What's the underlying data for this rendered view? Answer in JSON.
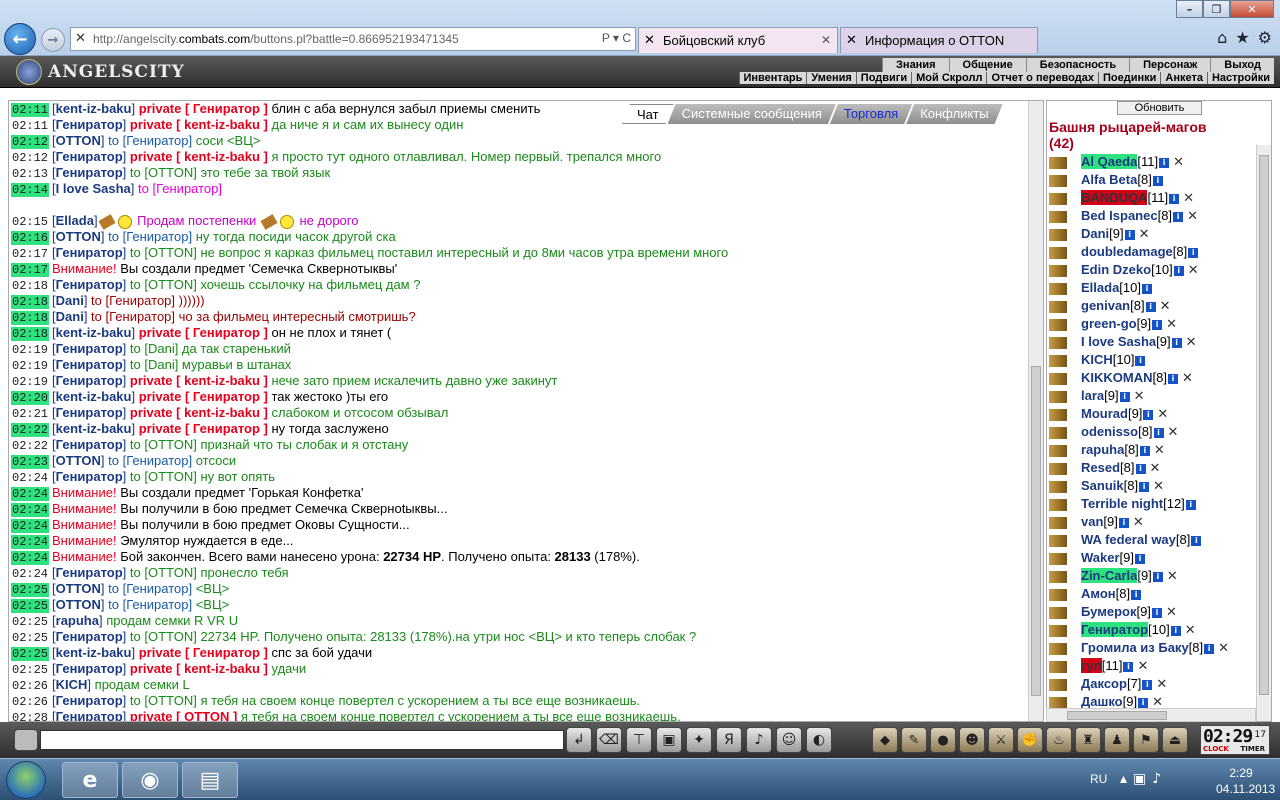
{
  "browser": {
    "url_prefix": "http://angelscity.",
    "url_host": "combats.com",
    "url_path": "/buttons.pl?battle=0.866952193471345",
    "url_tools": "P ▾ C",
    "tabs": [
      {
        "label": "Бойцовский клуб"
      },
      {
        "label": "Информация о OTTON"
      }
    ]
  },
  "site": {
    "logo": "ANGELSCITY",
    "menu_top": [
      "Знания",
      "Общение",
      "Безопасность",
      "Персонаж",
      "Выход"
    ],
    "menu_bottom": [
      "Инвентарь",
      "Умения",
      "Подвиги",
      "Мой Скролл",
      "Отчет о переводах",
      "Поединки",
      "Анкета",
      "Настройки"
    ]
  },
  "chat_tabs": [
    "Чат",
    "Системные сообщения",
    "Торговля",
    "Конфликты"
  ],
  "chat": [
    {
      "t": "02:11",
      "hl": true,
      "parts": [
        [
          "br",
          "["
        ],
        [
          "nick",
          "kent-iz-baku"
        ],
        [
          "br",
          "]"
        ],
        [
          "priv",
          " private [ Гениратор ] "
        ],
        [
          "sys",
          "блин с аба вернулся забыл приемы сменить"
        ]
      ]
    },
    {
      "t": "02:11",
      "hl": false,
      "parts": [
        [
          "br",
          "["
        ],
        [
          "nick",
          "Гениратор"
        ],
        [
          "br",
          "]"
        ],
        [
          "priv",
          " private [ kent-iz-baku ] "
        ],
        [
          "plain",
          "да ниче я и сам их вынесу один"
        ]
      ]
    },
    {
      "t": "02:12",
      "hl": true,
      "parts": [
        [
          "br",
          "["
        ],
        [
          "nick",
          "OTTON"
        ],
        [
          "br",
          "]"
        ],
        [
          "blue",
          " to [Гениратор] "
        ],
        [
          "plain",
          "соси <ВЦ>"
        ]
      ]
    },
    {
      "t": "02:12",
      "hl": false,
      "parts": [
        [
          "br",
          "["
        ],
        [
          "nick",
          "Гениратор"
        ],
        [
          "br",
          "]"
        ],
        [
          "priv",
          " private [ kent-iz-baku ] "
        ],
        [
          "plain",
          "я просто тут одного отлавливал. Номер первый. трепался много"
        ]
      ]
    },
    {
      "t": "02:13",
      "hl": false,
      "parts": [
        [
          "br",
          "["
        ],
        [
          "nick",
          "Гениратор"
        ],
        [
          "br",
          "]"
        ],
        [
          "plain",
          " to [OTTON] это тебе за твой язык"
        ]
      ]
    },
    {
      "t": "02:14",
      "hl": true,
      "parts": [
        [
          "br",
          "["
        ],
        [
          "nick",
          "I love Sasha"
        ],
        [
          "br",
          "]"
        ],
        [
          "magenta",
          " to [Гениратор]"
        ]
      ]
    },
    {
      "t": "",
      "hl": false,
      "parts": []
    },
    {
      "t": "02:15",
      "hl": false,
      "parts": [
        [
          "br",
          "["
        ],
        [
          "nick",
          "Ellada"
        ],
        [
          "br",
          "]"
        ],
        [
          "gavel",
          ""
        ],
        [
          "smiley",
          ""
        ],
        [
          "ellada",
          " Продам постепенки "
        ],
        [
          "gavel",
          ""
        ],
        [
          "smiley",
          ""
        ],
        [
          "ellada",
          " не дорого"
        ]
      ]
    },
    {
      "t": "02:16",
      "hl": true,
      "parts": [
        [
          "br",
          "["
        ],
        [
          "nick",
          "OTTON"
        ],
        [
          "br",
          "]"
        ],
        [
          "blue",
          " to [Гениратор] "
        ],
        [
          "plain",
          "ну тогда посиди часок другой ска"
        ]
      ]
    },
    {
      "t": "02:17",
      "hl": false,
      "parts": [
        [
          "br",
          "["
        ],
        [
          "nick",
          "Гениратор"
        ],
        [
          "br",
          "]"
        ],
        [
          "plain",
          " to [OTTON] не вопрос я карказ фильмец поставил интересный и до 8ми часов утра времени много"
        ]
      ]
    },
    {
      "t": "02:17",
      "hl": true,
      "parts": [
        [
          "warn",
          "Внимание! "
        ],
        [
          "sys",
          "Вы создали предмет 'Семечка Сквернотыквы'"
        ]
      ]
    },
    {
      "t": "02:18",
      "hl": false,
      "parts": [
        [
          "br",
          "["
        ],
        [
          "nick",
          "Гениратор"
        ],
        [
          "br",
          "]"
        ],
        [
          "plain",
          " to [OTTON] хочешь ссылочку на фильмец дам ?"
        ]
      ]
    },
    {
      "t": "02:18",
      "hl": true,
      "parts": [
        [
          "br",
          "["
        ],
        [
          "nick",
          "Dani"
        ],
        [
          "br",
          "]"
        ],
        [
          "darkred",
          " to [Гениратор] ))))))"
        ]
      ]
    },
    {
      "t": "02:18",
      "hl": true,
      "parts": [
        [
          "br",
          "["
        ],
        [
          "nick",
          "Dani"
        ],
        [
          "br",
          "]"
        ],
        [
          "darkred",
          " to [Гениратор] чо за фильмец интересный смотришь?"
        ]
      ]
    },
    {
      "t": "02:18",
      "hl": true,
      "parts": [
        [
          "br",
          "["
        ],
        [
          "nick",
          "kent-iz-baku"
        ],
        [
          "br",
          "]"
        ],
        [
          "priv",
          " private [ Гениратор ] "
        ],
        [
          "sys",
          "он не плох и тянет ("
        ]
      ]
    },
    {
      "t": "02:19",
      "hl": false,
      "parts": [
        [
          "br",
          "["
        ],
        [
          "nick",
          "Гениратор"
        ],
        [
          "br",
          "]"
        ],
        [
          "plain",
          " to [Dani] да так старенький"
        ]
      ]
    },
    {
      "t": "02:19",
      "hl": false,
      "parts": [
        [
          "br",
          "["
        ],
        [
          "nick",
          "Гениратор"
        ],
        [
          "br",
          "]"
        ],
        [
          "plain",
          " to [Dani] муравьи в штанах"
        ]
      ]
    },
    {
      "t": "02:19",
      "hl": false,
      "parts": [
        [
          "br",
          "["
        ],
        [
          "nick",
          "Гениратор"
        ],
        [
          "br",
          "]"
        ],
        [
          "priv",
          " private [ kent-iz-baku ] "
        ],
        [
          "plain",
          "нече зато прием искалечить давно уже закинут"
        ]
      ]
    },
    {
      "t": "02:20",
      "hl": true,
      "parts": [
        [
          "br",
          "["
        ],
        [
          "nick",
          "kent-iz-baku"
        ],
        [
          "br",
          "]"
        ],
        [
          "priv",
          " private [ Гениратор ] "
        ],
        [
          "sys",
          "так жестоко )ты его"
        ]
      ]
    },
    {
      "t": "02:21",
      "hl": false,
      "parts": [
        [
          "br",
          "["
        ],
        [
          "nick",
          "Гениратор"
        ],
        [
          "br",
          "]"
        ],
        [
          "priv",
          " private [ kent-iz-baku ] "
        ],
        [
          "plain",
          "слабоком и отсосом обзывал"
        ]
      ]
    },
    {
      "t": "02:22",
      "hl": true,
      "parts": [
        [
          "br",
          "["
        ],
        [
          "nick",
          "kent-iz-baku"
        ],
        [
          "br",
          "]"
        ],
        [
          "priv",
          " private [ Гениратор ] "
        ],
        [
          "sys",
          "ну тогда заслужено"
        ]
      ]
    },
    {
      "t": "02:22",
      "hl": false,
      "parts": [
        [
          "br",
          "["
        ],
        [
          "nick",
          "Гениратор"
        ],
        [
          "br",
          "]"
        ],
        [
          "plain",
          " to [OTTON] признай что ты слобак и я отстану"
        ]
      ]
    },
    {
      "t": "02:23",
      "hl": true,
      "parts": [
        [
          "br",
          "["
        ],
        [
          "nick",
          "OTTON"
        ],
        [
          "br",
          "]"
        ],
        [
          "blue",
          " to [Гениратор] "
        ],
        [
          "plain",
          "отсоси"
        ]
      ]
    },
    {
      "t": "02:24",
      "hl": false,
      "parts": [
        [
          "br",
          "["
        ],
        [
          "nick",
          "Гениратор"
        ],
        [
          "br",
          "]"
        ],
        [
          "plain",
          " to [OTTON] ну вот опять"
        ]
      ]
    },
    {
      "t": "02:24",
      "hl": true,
      "parts": [
        [
          "warn",
          "Внимание! "
        ],
        [
          "sys",
          "Вы создали предмет 'Горькая Конфетка'"
        ]
      ]
    },
    {
      "t": "02:24",
      "hl": true,
      "parts": [
        [
          "warn",
          "Внимание! "
        ],
        [
          "sys",
          "Вы получили в бою предмет Семечка Скверноtыквы..."
        ]
      ]
    },
    {
      "t": "02:24",
      "hl": true,
      "parts": [
        [
          "warn",
          "Внимание! "
        ],
        [
          "sys",
          "Вы получили в бою предмет Оковы Сущности..."
        ]
      ]
    },
    {
      "t": "02:24",
      "hl": true,
      "parts": [
        [
          "warn",
          "Внимание! "
        ],
        [
          "sys",
          "Эмулятор нуждается в еде..."
        ]
      ]
    },
    {
      "t": "02:24",
      "hl": true,
      "parts": [
        [
          "warn",
          "Внимание! "
        ],
        [
          "sys",
          "Бой закончен. Всего вами нанесено урона: "
        ],
        [
          "sysb",
          "22734 HP"
        ],
        [
          "sys",
          ". Получено опыта: "
        ],
        [
          "sysb",
          "28133"
        ],
        [
          "sys",
          " (178%)."
        ]
      ]
    },
    {
      "t": "02:24",
      "hl": false,
      "parts": [
        [
          "br",
          "["
        ],
        [
          "nick",
          "Гениратор"
        ],
        [
          "br",
          "]"
        ],
        [
          "plain",
          " to [OTTON] пронесло тебя"
        ]
      ]
    },
    {
      "t": "02:25",
      "hl": true,
      "parts": [
        [
          "br",
          "["
        ],
        [
          "nick",
          "OTTON"
        ],
        [
          "br",
          "]"
        ],
        [
          "blue",
          " to [Гениратор] "
        ],
        [
          "plain",
          "<ВЦ>"
        ]
      ]
    },
    {
      "t": "02:25",
      "hl": true,
      "parts": [
        [
          "br",
          "["
        ],
        [
          "nick",
          "OTTON"
        ],
        [
          "br",
          "]"
        ],
        [
          "blue",
          " to [Гениратор] "
        ],
        [
          "plain",
          "<ВЦ>"
        ]
      ]
    },
    {
      "t": "02:25",
      "hl": false,
      "parts": [
        [
          "br",
          "["
        ],
        [
          "nick",
          "rapuha"
        ],
        [
          "br",
          "]"
        ],
        [
          "plain",
          " продам семки R VR U"
        ]
      ]
    },
    {
      "t": "02:25",
      "hl": false,
      "parts": [
        [
          "br",
          "["
        ],
        [
          "nick",
          "Гениратор"
        ],
        [
          "br",
          "]"
        ],
        [
          "plain",
          " to [OTTON] 22734 HP. Получено опыта: 28133 (178%).на утри нос <ВЦ> и кто теперь слобак ?"
        ]
      ]
    },
    {
      "t": "02:25",
      "hl": true,
      "parts": [
        [
          "br",
          "["
        ],
        [
          "nick",
          "kent-iz-baku"
        ],
        [
          "br",
          "]"
        ],
        [
          "priv",
          " private [ Гениратор ] "
        ],
        [
          "sys",
          "спс за бой удачи"
        ]
      ]
    },
    {
      "t": "02:25",
      "hl": false,
      "parts": [
        [
          "br",
          "["
        ],
        [
          "nick",
          "Гениратор"
        ],
        [
          "br",
          "]"
        ],
        [
          "priv",
          " private [ kent-iz-baku ] "
        ],
        [
          "plain",
          "удачи"
        ]
      ]
    },
    {
      "t": "02:26",
      "hl": false,
      "parts": [
        [
          "br",
          "["
        ],
        [
          "nick",
          "KICH"
        ],
        [
          "br",
          "]"
        ],
        [
          "plain",
          " продам семки L"
        ]
      ]
    },
    {
      "t": "02:26",
      "hl": false,
      "parts": [
        [
          "br",
          "["
        ],
        [
          "nick",
          "Гениратор"
        ],
        [
          "br",
          "]"
        ],
        [
          "plain",
          " to [OTTON] я тебя на своем конце повертел с ускорением а ты все еще возникаешь."
        ]
      ]
    },
    {
      "t": "02:28",
      "hl": false,
      "parts": [
        [
          "br",
          "["
        ],
        [
          "nick",
          "Гениратор"
        ],
        [
          "br",
          "]"
        ],
        [
          "priv",
          " private [ OTTON ] "
        ],
        [
          "plain",
          "я тебя на своем конце повертел с ускорением а ты все еще возникаешь."
        ]
      ]
    }
  ],
  "panel": {
    "refresh_label": "Обновить",
    "room_title": "Башня рыцарей-магов",
    "room_count": "(42)",
    "users": [
      {
        "name": "Al Qaeda",
        "level": "[11]",
        "hl": "g",
        "x": true
      },
      {
        "name": "Alfa Beta",
        "level": "[8]",
        "hl": "",
        "x": false
      },
      {
        "name": "BANDUQA",
        "level": "[11]",
        "hl": "r",
        "x": true
      },
      {
        "name": "Bed Ispanec",
        "level": "[8]",
        "hl": "",
        "x": true
      },
      {
        "name": "Dani",
        "level": "[9]",
        "hl": "",
        "x": true
      },
      {
        "name": "doubledamage",
        "level": "[8]",
        "hl": "",
        "x": false
      },
      {
        "name": "Edin Dzeko",
        "level": "[10]",
        "hl": "",
        "x": true
      },
      {
        "name": "Ellada",
        "level": "[10]",
        "hl": "",
        "x": false
      },
      {
        "name": "genivan",
        "level": "[8]",
        "hl": "",
        "x": true
      },
      {
        "name": "green-go",
        "level": "[9]",
        "hl": "",
        "x": true
      },
      {
        "name": "I love Sasha",
        "level": "[9]",
        "hl": "",
        "x": true
      },
      {
        "name": "KICH",
        "level": "[10]",
        "hl": "",
        "x": false
      },
      {
        "name": "KIKKOMAN",
        "level": "[8]",
        "hl": "",
        "x": true
      },
      {
        "name": "lara",
        "level": "[9]",
        "hl": "",
        "x": true
      },
      {
        "name": "Mourad",
        "level": "[9]",
        "hl": "",
        "x": true
      },
      {
        "name": "odenisso",
        "level": "[8]",
        "hl": "",
        "x": true
      },
      {
        "name": "rapuha",
        "level": "[8]",
        "hl": "",
        "x": true
      },
      {
        "name": "Resed",
        "level": "[8]",
        "hl": "",
        "x": true
      },
      {
        "name": "Sanuik",
        "level": "[8]",
        "hl": "",
        "x": true
      },
      {
        "name": "Terrible night",
        "level": "[12]",
        "hl": "",
        "x": false
      },
      {
        "name": "van",
        "level": "[9]",
        "hl": "",
        "x": true
      },
      {
        "name": "WA federal way",
        "level": "[8]",
        "hl": "",
        "x": false
      },
      {
        "name": "Waker",
        "level": "[9]",
        "hl": "",
        "x": false
      },
      {
        "name": "Zin-Carla",
        "level": "[9]",
        "hl": "g",
        "x": true
      },
      {
        "name": "Амон",
        "level": "[8]",
        "hl": "",
        "x": false
      },
      {
        "name": "Бумерок",
        "level": "[9]",
        "hl": "",
        "x": true
      },
      {
        "name": "Гениратор",
        "level": "[10]",
        "hl": "g",
        "x": true
      },
      {
        "name": "Громила из Баку",
        "level": "[8]",
        "hl": "",
        "x": true
      },
      {
        "name": "гул",
        "level": "[11]",
        "hl": "r",
        "x": true
      },
      {
        "name": "Даксор",
        "level": "[7]",
        "hl": "",
        "x": true
      },
      {
        "name": "Дашко",
        "level": "[9]",
        "hl": "",
        "x": true
      }
    ]
  },
  "bottom": {
    "clock_time": "02:29",
    "clock_seconds": "17",
    "clock_label": "CLOCK",
    "timer_label": "TIMER"
  },
  "taskbar": {
    "lang": "RU",
    "time": "2:29",
    "date": "04.11.2013"
  }
}
